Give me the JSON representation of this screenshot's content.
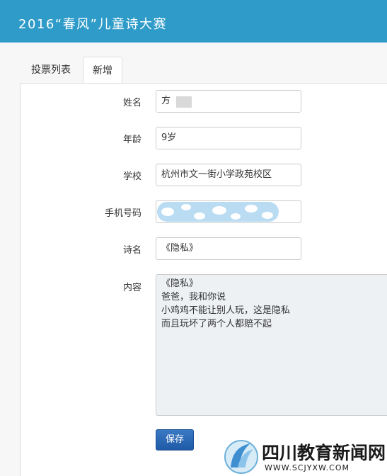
{
  "header": {
    "title": "2016“春风”儿童诗大赛"
  },
  "tabs": [
    {
      "label": "投票列表",
      "active": false
    },
    {
      "label": "新增",
      "active": true
    }
  ],
  "form": {
    "name_label": "姓名",
    "name_value": "方",
    "age_label": "年龄",
    "age_value": "9岁",
    "school_label": "学校",
    "school_value": "杭州市文一街小学政苑校区",
    "phone_label": "手机号码",
    "poem_title_label": "诗名",
    "poem_title_value": "《隐私》",
    "content_label": "内容",
    "content_lines": [
      "《隐私》",
      "爸爸，我和你说",
      "小鸡鸡不能让别人玩，这是隐私",
      "而且玩坏了两个人都赔不起"
    ],
    "save_label": "保存"
  },
  "watermark": {
    "name": "四川教育新闻网",
    "url": "WWW.SCJYXW.COM"
  },
  "colors": {
    "header": "#2f9bc8",
    "save_button": "#2a66b3",
    "textarea_bg": "#eef1f4"
  }
}
